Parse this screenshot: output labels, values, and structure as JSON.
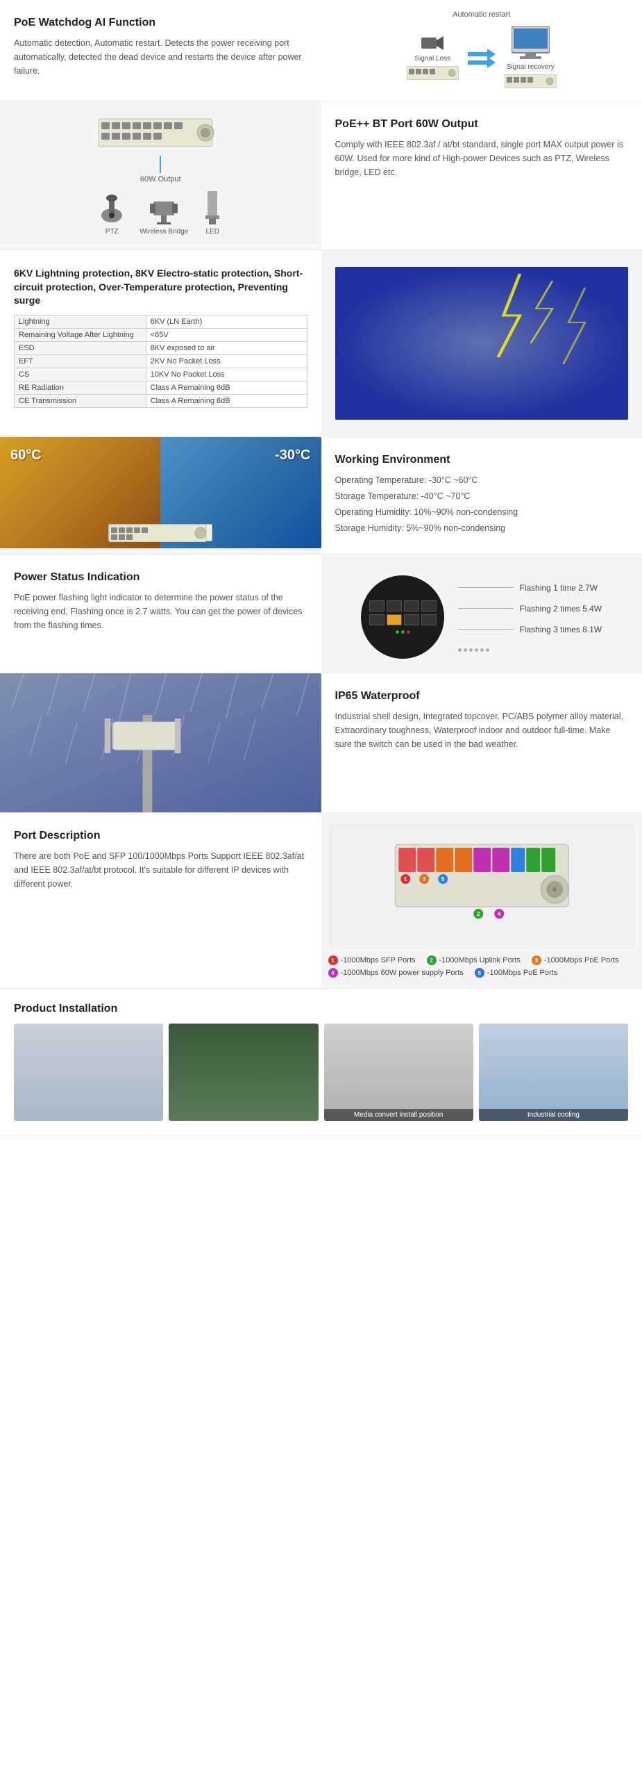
{
  "sections": {
    "watchdog": {
      "title": "PoE Watchdog AI Function",
      "description": "Automatic detection, Automatic restart. Detects the power receiving port automatically, detected the dead device and restarts the device after power failure.",
      "auto_restart_label": "Automatic restart",
      "signal_loss_label": "Signal Loss",
      "signal_recovery_label": "Signal recovery"
    },
    "poe_bt": {
      "title": "PoE++ BT Port 60W Output",
      "description": "Comply with IEEE 802.3af / at/bt standard, single port MAX output power is 60W. Used for more kind of High-power Devices such as PTZ, Wireless bridge, LED etc.",
      "output_label": "60W Output",
      "ptz_label": "PTZ",
      "bridge_label": "Wireless Bridge",
      "led_label": "LED"
    },
    "protection": {
      "title": "6KV Lightning protection, 8KV Electro-static protection, Short-circuit protection, Over-Temperature protection, Preventing surge",
      "table": [
        {
          "feature": "Lightning",
          "value": "6KV (LN Earth)"
        },
        {
          "feature": "Remaining Voltage After Lightning",
          "value": "<65V"
        },
        {
          "feature": "ESD",
          "value": "8KV exposed to air"
        },
        {
          "feature": "EFT",
          "value": "2KV No Packet Loss"
        },
        {
          "feature": "CS",
          "value": "10KV No Packet Loss"
        },
        {
          "feature": "RE Radiation",
          "value": "Class A Remaining 6dB"
        },
        {
          "feature": "CE Transmission",
          "value": "Class A Remaining 6dB"
        }
      ]
    },
    "working_env": {
      "title": "Working Environment",
      "temp_hot": "60°C",
      "temp_cold": "-30°C",
      "lines": [
        "Operating Temperature: -30°C ~60°C",
        "Storage Temperature: -40°C ~70°C",
        "Operating Humidity: 10%~90% non-condensing",
        "Storage Humidity: 5%~90% non-condensing"
      ]
    },
    "power_status": {
      "title": "Power Status Indication",
      "description": "PoE power flashing light indicator to determine the power status of the receiving end, Flashing once is 2.7 watts. You can get the power of devices from the flashing times.",
      "flash_labels": [
        "Flashing 1 time 2.7W",
        "Flashing 2 times 5.4W",
        "Flashing 3 times 8.1W"
      ]
    },
    "ip65": {
      "title": "IP65 Waterproof",
      "description": "Industrial shell design, Integrated topcover. PC/ABS polymer alloy material, Extraordinary toughness, Waterproof indoor and outdoor full-time. Make sure the switch can be used in the bad weather."
    },
    "port_desc": {
      "title": "Port Description",
      "description": "There are both PoE and SFP 100/1000Mbps Ports Support IEEE 802.3af/at and IEEE 802.3af/at/bt protocol. It's suitable for different IP devices with different power.",
      "legend": [
        {
          "num": "1",
          "color": "#e03030",
          "label": "-1000Mbps SFP Ports"
        },
        {
          "num": "2",
          "color": "#30a030",
          "label": "-1000Mbps Uplink Ports"
        },
        {
          "num": "3",
          "color": "#e07820",
          "label": "-1000Mbps PoE Ports"
        },
        {
          "num": "4",
          "color": "#c030c0",
          "label": "-1000Mbps 60W power supply Ports"
        },
        {
          "num": "5",
          "color": "#3070e0",
          "label": "-100Mbps PoE Ports"
        }
      ]
    },
    "installation": {
      "title": "Product Installation",
      "items": [
        {
          "label": "",
          "bg": "install-1"
        },
        {
          "label": "",
          "bg": "install-2"
        },
        {
          "label": "Media convert install position",
          "bg": "install-3"
        },
        {
          "label": "Industrial cooling",
          "bg": "install-4"
        }
      ]
    }
  }
}
